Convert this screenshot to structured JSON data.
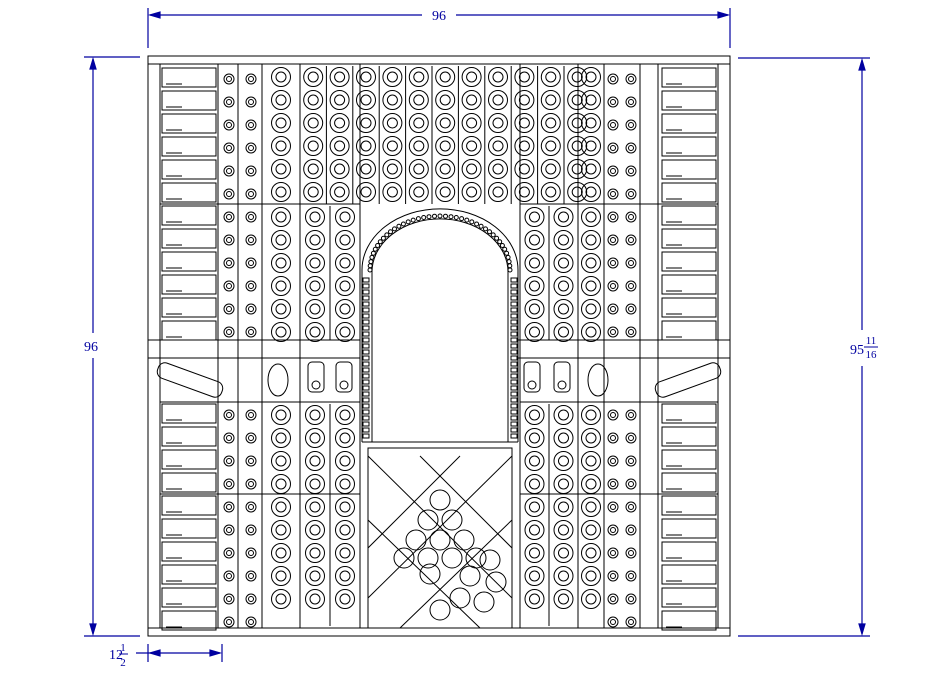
{
  "drawing": {
    "dimensions": {
      "top_width": "96",
      "left_height": "96",
      "right_height_whole": "95",
      "right_height_num": "11",
      "right_height_den": "16",
      "bottom_depth_whole": "12",
      "bottom_depth_num": "1",
      "bottom_depth_den": "2"
    },
    "colors": {
      "dimension": "#0000a0",
      "line": "#000000",
      "background": "#ffffff"
    }
  }
}
